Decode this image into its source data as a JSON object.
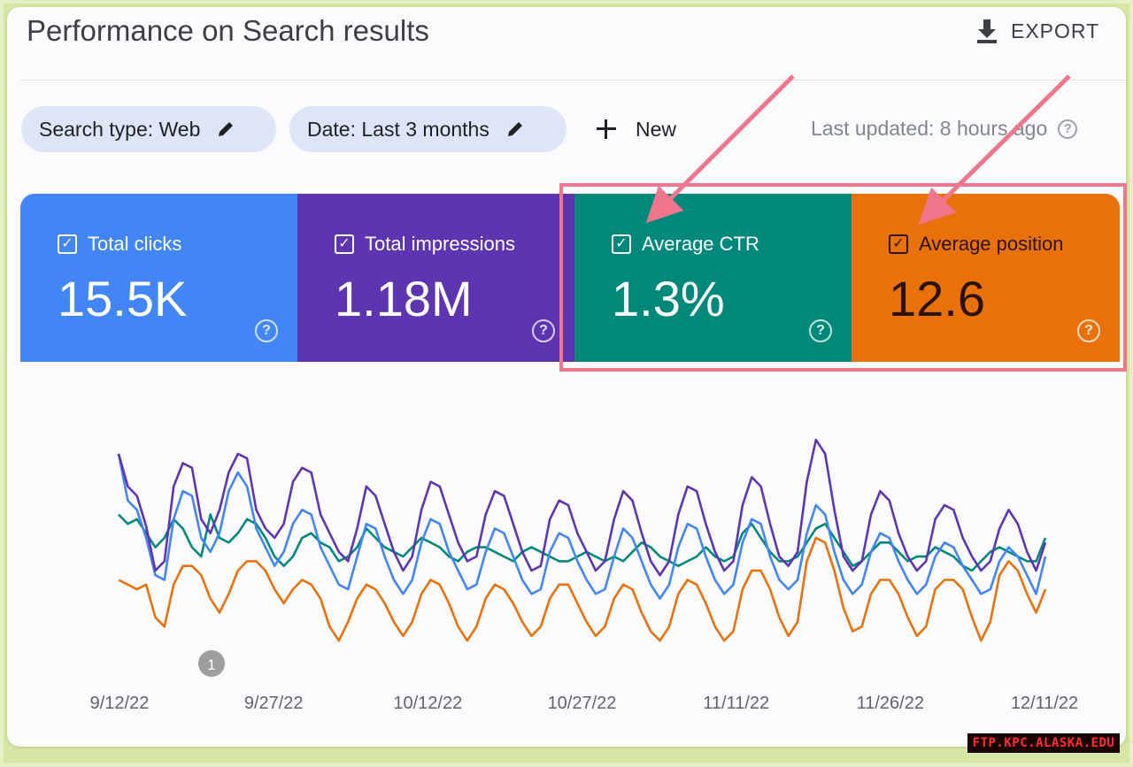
{
  "header": {
    "title": "Performance on Search results",
    "export_label": "EXPORT",
    "export_icon": "download-icon"
  },
  "filters": {
    "search_type": "Search type: Web",
    "date": "Date: Last 3 months",
    "new_label": "New",
    "last_updated": "Last updated: 8 hours ago",
    "edit_icon": "pencil-icon"
  },
  "metrics": [
    {
      "label": "Total clicks",
      "value": "15.5K",
      "checked": true,
      "color": "#4285f4"
    },
    {
      "label": "Total impressions",
      "value": "1.18M",
      "checked": true,
      "color": "#5e35b1"
    },
    {
      "label": "Average CTR",
      "value": "1.3%",
      "checked": true,
      "color": "#00897b"
    },
    {
      "label": "Average position",
      "value": "12.6",
      "checked": true,
      "color": "#e8710a"
    }
  ],
  "annotation_marker": "1",
  "watermark": "FTP.KPC.ALASKA.EDU",
  "chart_data": {
    "type": "line",
    "x_tick_labels": [
      "9/12/22",
      "9/27/22",
      "10/12/22",
      "10/27/22",
      "11/11/22",
      "11/26/22",
      "12/11/22"
    ],
    "x_start": "9/12/22",
    "x_end": "12/11/22",
    "ylim": [
      0,
      100
    ],
    "grid": false,
    "legend": "metric cards above chart",
    "series": [
      {
        "name": "Total impressions",
        "color": "#5e35b1",
        "values": [
          86,
          72,
          68,
          55,
          36,
          40,
          72,
          82,
          80,
          58,
          52,
          62,
          78,
          86,
          84,
          62,
          54,
          50,
          56,
          74,
          80,
          78,
          60,
          52,
          44,
          40,
          54,
          72,
          68,
          56,
          44,
          36,
          42,
          62,
          74,
          72,
          60,
          48,
          40,
          42,
          60,
          70,
          68,
          56,
          44,
          36,
          38,
          58,
          66,
          64,
          52,
          44,
          36,
          40,
          58,
          70,
          66,
          52,
          40,
          34,
          40,
          60,
          72,
          70,
          56,
          44,
          36,
          40,
          64,
          76,
          72,
          56,
          42,
          38,
          44,
          74,
          92,
          86,
          62,
          42,
          36,
          40,
          60,
          70,
          66,
          52,
          42,
          36,
          40,
          58,
          64,
          62,
          50,
          42,
          36,
          40,
          54,
          62,
          56,
          44,
          36,
          48
        ]
      },
      {
        "name": "Total clicks",
        "color": "#4285f4",
        "values": [
          86,
          66,
          62,
          50,
          34,
          32,
          58,
          70,
          68,
          50,
          44,
          52,
          70,
          78,
          72,
          54,
          46,
          38,
          44,
          56,
          62,
          60,
          46,
          38,
          30,
          28,
          42,
          56,
          54,
          42,
          32,
          26,
          32,
          48,
          58,
          56,
          44,
          36,
          28,
          30,
          44,
          54,
          52,
          42,
          32,
          26,
          28,
          44,
          52,
          50,
          40,
          32,
          26,
          28,
          42,
          54,
          50,
          40,
          30,
          24,
          30,
          46,
          56,
          54,
          42,
          32,
          26,
          30,
          48,
          58,
          56,
          42,
          32,
          28,
          32,
          52,
          64,
          60,
          44,
          32,
          26,
          30,
          44,
          52,
          50,
          40,
          32,
          26,
          30,
          42,
          48,
          46,
          38,
          32,
          26,
          28,
          40,
          46,
          42,
          34,
          26,
          42
        ]
      },
      {
        "name": "Average CTR",
        "color": "#00897b",
        "values": [
          60,
          56,
          58,
          52,
          46,
          50,
          58,
          54,
          46,
          42,
          60,
          50,
          48,
          52,
          58,
          56,
          50,
          42,
          38,
          42,
          50,
          52,
          48,
          46,
          40,
          42,
          46,
          54,
          50,
          46,
          44,
          42,
          46,
          50,
          48,
          46,
          42,
          40,
          44,
          46,
          46,
          44,
          42,
          40,
          44,
          46,
          44,
          42,
          40,
          40,
          42,
          44,
          42,
          40,
          42,
          40,
          44,
          48,
          46,
          42,
          40,
          38,
          40,
          42,
          46,
          42,
          40,
          42,
          52,
          56,
          50,
          44,
          40,
          40,
          42,
          48,
          54,
          56,
          50,
          44,
          38,
          40,
          44,
          48,
          48,
          44,
          40,
          42,
          42,
          46,
          44,
          42,
          38,
          36,
          40,
          44,
          46,
          44,
          42,
          40,
          40,
          50
        ]
      },
      {
        "name": "Average position",
        "color": "#e8710a",
        "values": [
          32,
          30,
          28,
          30,
          16,
          12,
          30,
          38,
          38,
          34,
          24,
          18,
          26,
          36,
          40,
          40,
          36,
          28,
          22,
          28,
          32,
          30,
          24,
          12,
          6,
          14,
          24,
          30,
          28,
          22,
          14,
          8,
          14,
          26,
          32,
          30,
          22,
          12,
          6,
          12,
          24,
          30,
          28,
          22,
          14,
          8,
          12,
          24,
          30,
          30,
          22,
          14,
          8,
          12,
          24,
          30,
          28,
          18,
          10,
          6,
          12,
          26,
          32,
          30,
          22,
          12,
          6,
          10,
          28,
          36,
          36,
          28,
          16,
          8,
          14,
          40,
          50,
          48,
          36,
          20,
          10,
          12,
          26,
          32,
          32,
          26,
          16,
          8,
          12,
          28,
          32,
          32,
          28,
          16,
          6,
          14,
          34,
          40,
          36,
          26,
          18,
          28
        ]
      }
    ]
  }
}
